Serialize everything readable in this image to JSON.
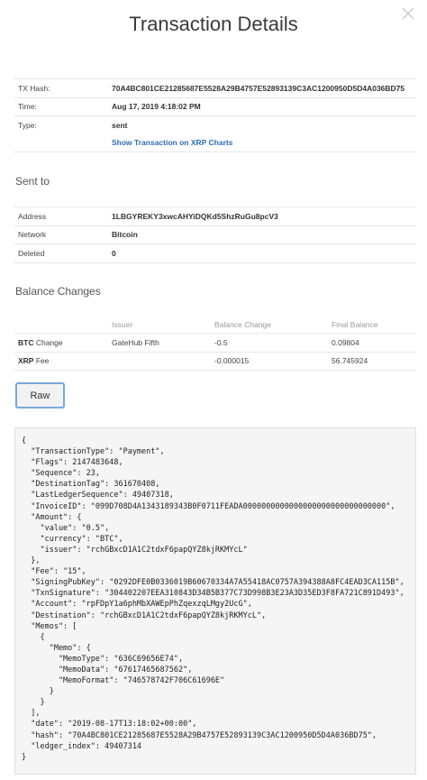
{
  "modal": {
    "title": "Transaction Details",
    "close_icon": "close-icon"
  },
  "details": {
    "tx_hash_label": "TX Hash:",
    "tx_hash": "70A4BC801CE21285687E5528A29B4757E52893139C3AC1200950D5D4A036BD75",
    "time_label": "Time:",
    "time": "Aug 17, 2019 4:18:02 PM",
    "type_label": "Type:",
    "type": "sent",
    "chart_link": "Show Transaction on XRP Charts"
  },
  "sent_to": {
    "heading": "Sent to",
    "address_label": "Address",
    "address": "1LBGYREKY3xwcAHYiDQKd5ShzRuGu8pcV3",
    "network_label": "Network",
    "network": "Bitcoin",
    "deleted_label": "Deleted",
    "deleted": "0"
  },
  "balance": {
    "heading": "Balance Changes",
    "columns": [
      "",
      "Issuer",
      "Balance Change",
      "Final Balance"
    ],
    "rows": [
      {
        "currency": "BTC",
        "kind": "Change",
        "issuer": "GateHub Fifth",
        "change": "-0.5",
        "final": "0.09804"
      },
      {
        "currency": "XRP",
        "kind": "Fee",
        "issuer": "",
        "change": "-0.000015",
        "final": "56.745924"
      }
    ]
  },
  "raw_button": "Raw",
  "raw_json": "{\n  \"TransactionType\": \"Payment\",\n  \"Flags\": 2147483648,\n  \"Sequence\": 23,\n  \"DestinationTag\": 361670408,\n  \"LastLedgerSequence\": 49407318,\n  \"InvoiceID\": \"099D708D4A1343189343B0F0711FEADA0000000000000000000000000000000\",\n  \"Amount\": {\n    \"value\": \"0.5\",\n    \"currency\": \"BTC\",\n    \"issuer\": \"rchGBxcD1A1C2tdxF6papQYZ8kjRKMYcL\"\n  },\n  \"Fee\": \"15\",\n  \"SigningPubKey\": \"0292DFE0B0336019B60670334A7A55418AC0757A394388A8FC4EAD3CA115B\",\n  \"TxnSignature\": \"304402207EEA310843D34B5B377C73D998B3E23A3D35ED3F8FA721C891D493\",\n  \"Account\": \"rpFDpY1a6phMbXAWEpPhZqexzqLMgy2UcG\",\n  \"Destination\": \"rchGBxcD1A1C2tdxF6papQYZ8kjRKMYcL\",\n  \"Memos\": [\n    {\n      \"Memo\": {\n        \"MemoType\": \"636C69656E74\",\n        \"MemoData\": \"67617465687562\",\n        \"MemoFormat\": \"746578742F706C61696E\"\n      }\n    }\n  ],\n  \"date\": \"2019-08-17T13:18:02+00:00\",\n  \"hash\": \"70A4BC801CE21285687E5528A29B4757E52893139C3AC1200950D5D4A036BD75\",\n  \"ledger_index\": 49407314\n}"
}
